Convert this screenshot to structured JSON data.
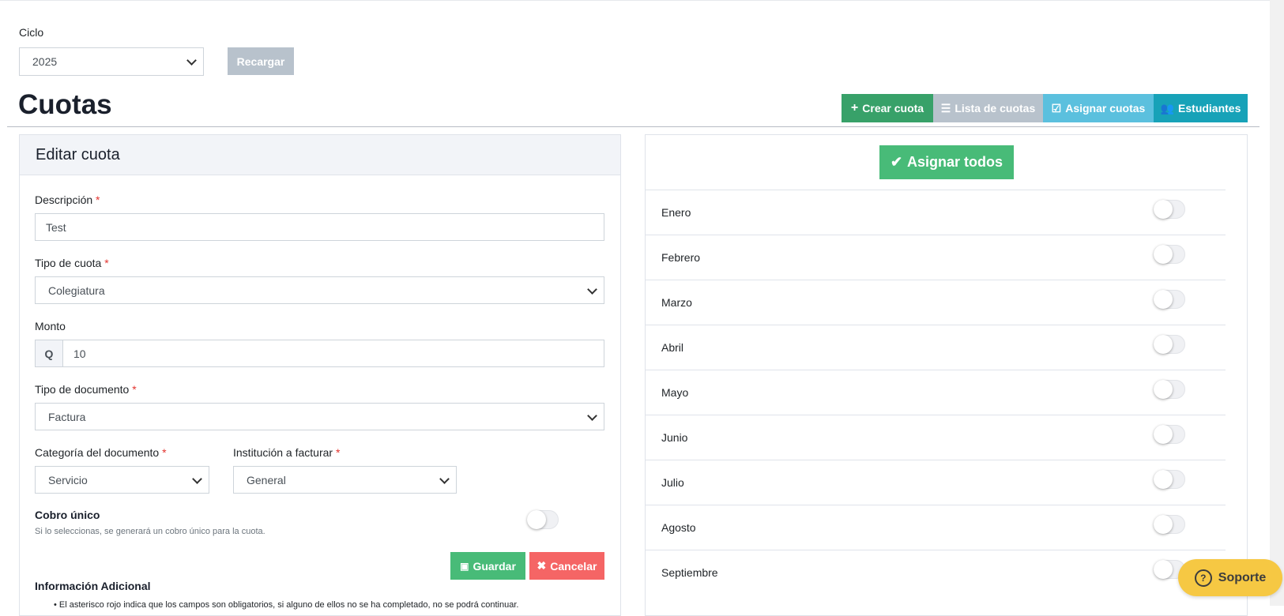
{
  "ciclo": {
    "label": "Ciclo",
    "value": "2025",
    "reload_label": "Recargar"
  },
  "page": {
    "title": "Cuotas"
  },
  "toolbar": {
    "create": "Crear cuota",
    "list": "Lista de cuotas",
    "assign": "Asignar cuotas",
    "students": "Estudiantes"
  },
  "edit_form": {
    "title": "Editar cuota",
    "required_mark": "*",
    "description": {
      "label": "Descripción",
      "value": "Test"
    },
    "fee_type": {
      "label": "Tipo de cuota",
      "value": "Colegiatura"
    },
    "amount": {
      "label": "Monto",
      "prefix": "Q",
      "value": "10"
    },
    "doc_type": {
      "label": "Tipo de documento",
      "value": "Factura"
    },
    "doc_category": {
      "label": "Categoría del documento",
      "value": "Servicio"
    },
    "institution": {
      "label": "Institución a facturar",
      "value": "General"
    },
    "single_charge": {
      "label": "Cobro único",
      "hint": "Si lo seleccionas, se generará un cobro único para la cuota.",
      "enabled": false
    },
    "save_label": "Guardar",
    "cancel_label": "Cancelar",
    "extra_title": "Información Adicional",
    "extra_note": "El asterisco rojo indica que los campos son obligatorios, si alguno de ellos no se ha completado, no se podrá continuar."
  },
  "months_panel": {
    "assign_all_label": "Asignar todos",
    "months": [
      {
        "name": "Enero",
        "enabled": false
      },
      {
        "name": "Febrero",
        "enabled": false
      },
      {
        "name": "Marzo",
        "enabled": false
      },
      {
        "name": "Abril",
        "enabled": false
      },
      {
        "name": "Mayo",
        "enabled": false
      },
      {
        "name": "Junio",
        "enabled": false
      },
      {
        "name": "Julio",
        "enabled": false
      },
      {
        "name": "Agosto",
        "enabled": false
      },
      {
        "name": "Septiembre",
        "enabled": false
      }
    ]
  },
  "support": {
    "label": "Soporte",
    "icon": "question-circle-icon"
  },
  "colors": {
    "green": "#38a169",
    "green_light": "#48bb78",
    "gray": "#b8c2cc",
    "light_blue": "#5bc0de",
    "teal": "#17a2b8",
    "red": "#f56565",
    "yellow": "#f6c843"
  }
}
